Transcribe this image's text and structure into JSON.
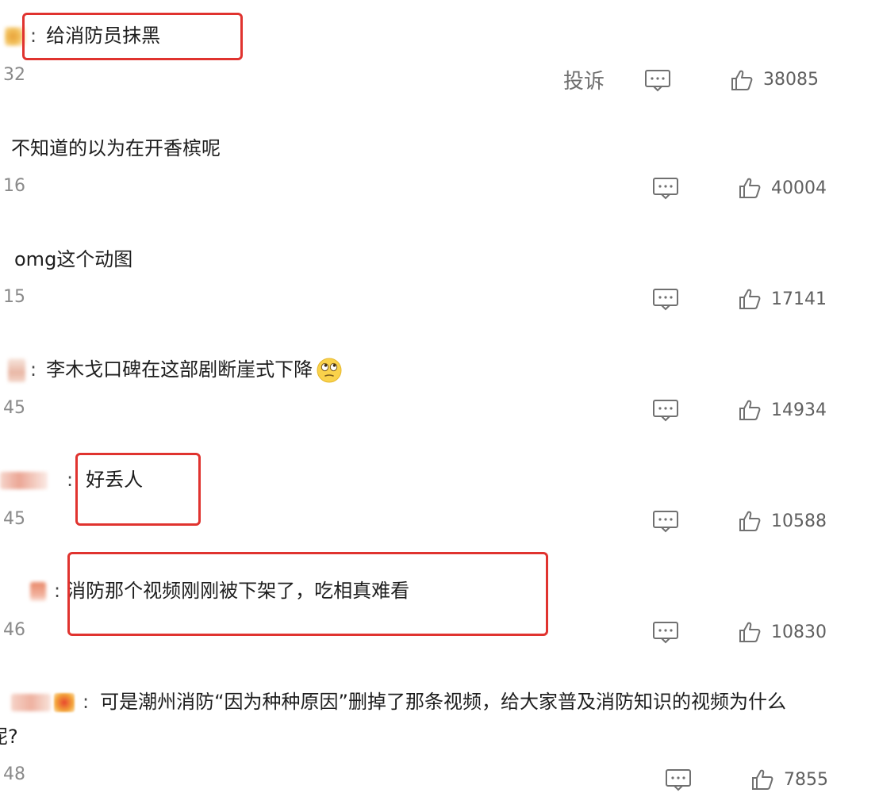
{
  "comments": [
    {
      "text": "给消防员抹黑",
      "time_prefix": "32",
      "report_label": "投诉",
      "likes": "38085"
    },
    {
      "text": "不知道的以为在开香槟呢",
      "time_prefix": "16",
      "likes": "40004"
    },
    {
      "text": "omg这个动图",
      "time_prefix": "15",
      "likes": "17141"
    },
    {
      "text": "李木戈口碑在这部剧断崖式下降",
      "time_prefix": "45",
      "likes": "14934"
    },
    {
      "text": "好丢人",
      "time_prefix": "45",
      "likes": "10588"
    },
    {
      "text": "消防那个视频刚刚被下架了，吃相真难看",
      "time_prefix": "46",
      "likes": "10830"
    },
    {
      "text": "可是潮州消防“因为种种原因”删掉了那条视频，给大家普及消防知识的视频为什么",
      "text_line2": "呢?",
      "time_prefix": "48",
      "likes": "7855"
    }
  ],
  "separator": ":",
  "icons": {
    "reply": "comment-bubble-icon",
    "like": "thumbs-up-icon",
    "emoji": "eye-roll-face-icon"
  },
  "colors": {
    "highlight": "#e0332f",
    "meta_text": "#8a8a8a",
    "icon_stroke": "#707070"
  }
}
